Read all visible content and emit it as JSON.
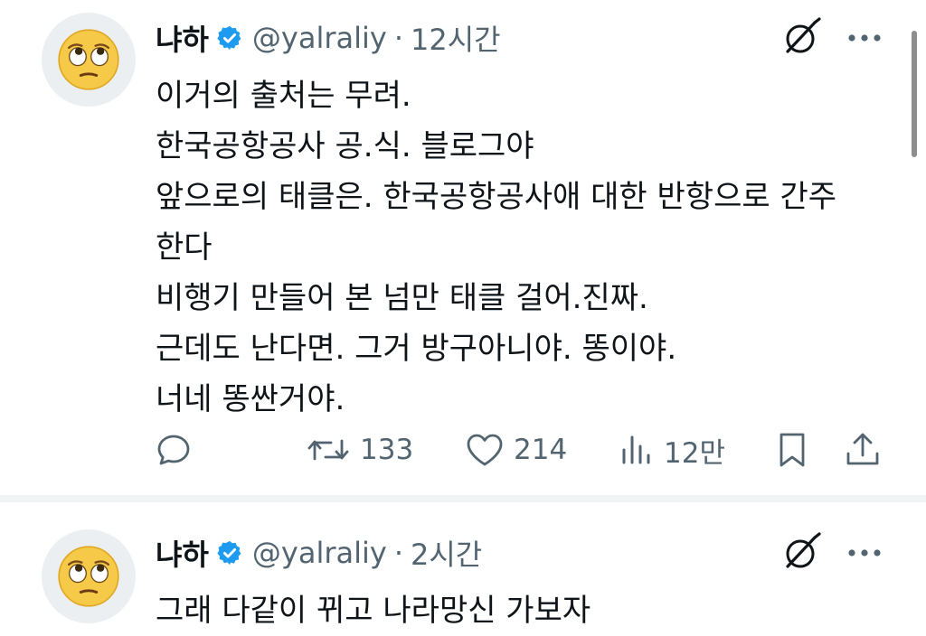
{
  "tweets": [
    {
      "author_name": "냐하",
      "handle": "@yalraliy",
      "separator": "·",
      "time": "12시간",
      "lines": [
        "이거의 출처는 무려.",
        "한국공항공사 공.식. 블로그야",
        "앞으로의 태클은. 한국공항공사애 대한 반항으로 간주",
        "한다",
        "비행기 만들어 본 넘만 태클 걸어.진짜.",
        "근데도 난다면. 그거 방구아니야. 똥이야.",
        "너네 똥싼거야."
      ],
      "actions": {
        "reply_count": "",
        "retweet_count": "133",
        "like_count": "214",
        "views_count": "12만"
      }
    },
    {
      "author_name": "냐하",
      "handle": "@yalraliy",
      "separator": "·",
      "time": "2시간",
      "text": "그래 다같이 뀌고 나라망신 가보자"
    }
  ],
  "icons": {
    "avatar": "face-with-rolling-eyes-emoji",
    "verified": "verified-badge-icon",
    "grok": "grok-icon",
    "more": "more-icon",
    "reply": "reply-icon",
    "retweet": "retweet-icon",
    "like": "heart-icon",
    "views": "views-icon",
    "bookmark": "bookmark-icon",
    "share": "share-icon"
  },
  "colors": {
    "text": "#0f1419",
    "secondary": "#536471",
    "verified": "#1d9bf0",
    "divider": "#eff3f4"
  }
}
